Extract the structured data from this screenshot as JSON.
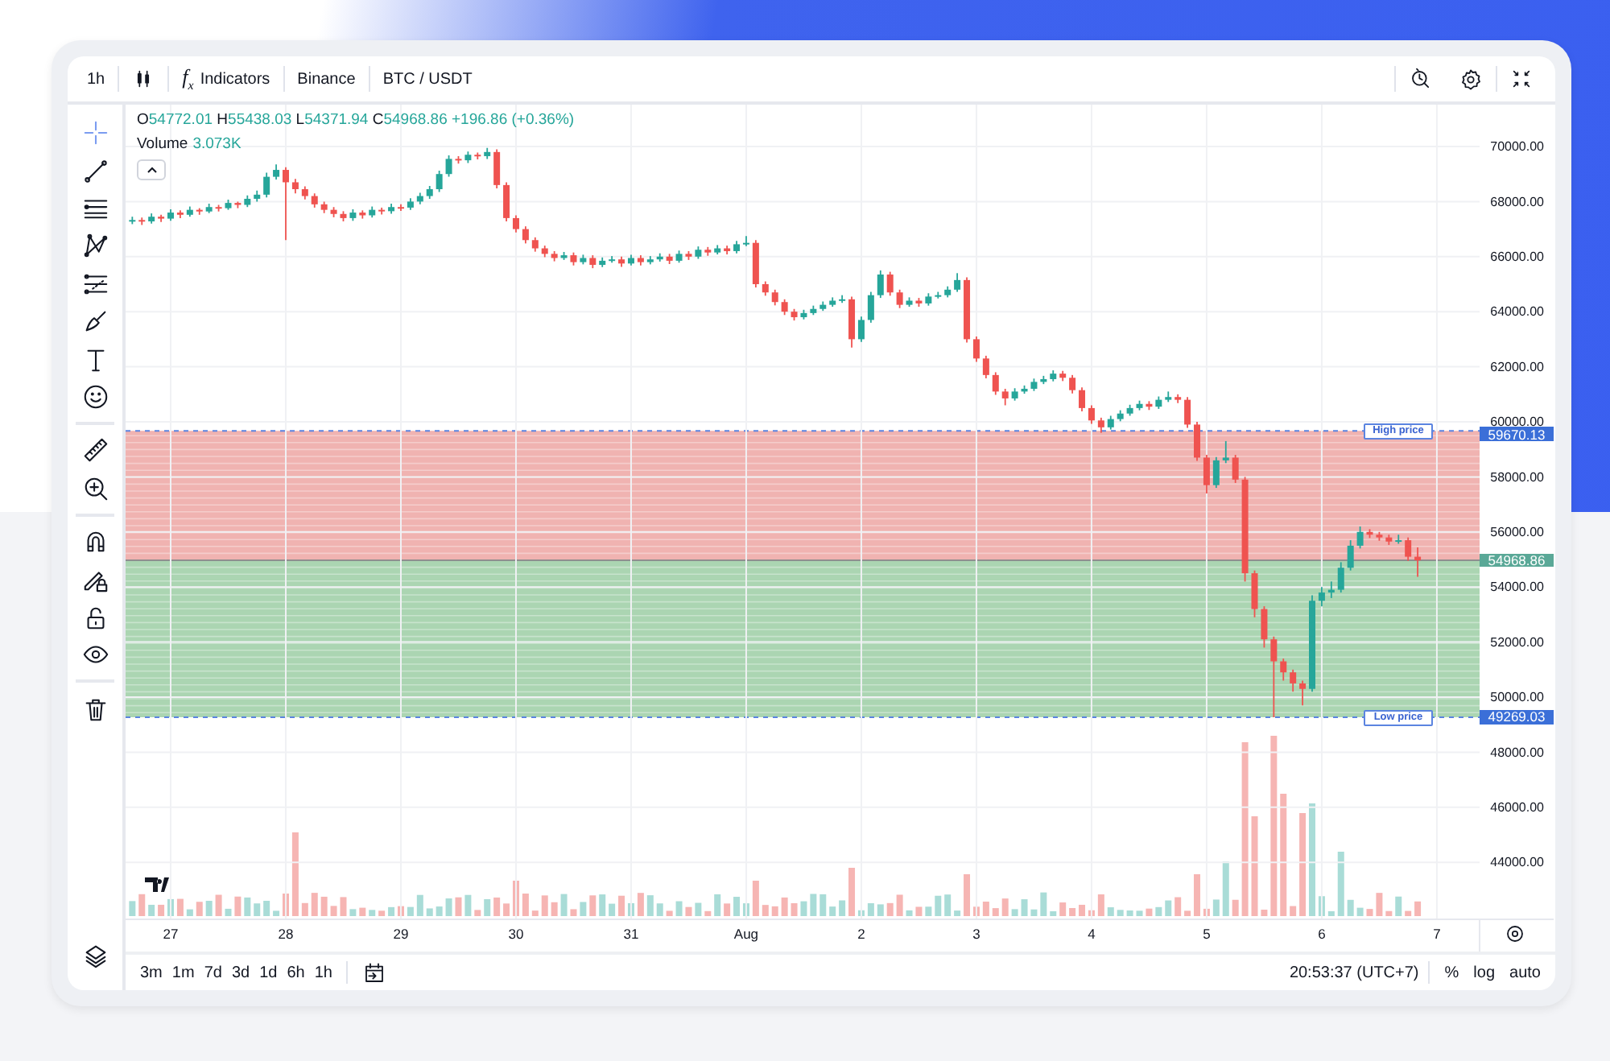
{
  "toolbar": {
    "interval": "1h",
    "indicators_symbol": "f$_{x}$",
    "indicators_label": "Indicators",
    "exchange": "Binance",
    "symbol": "BTC / USDT"
  },
  "legend": {
    "open_label": "O",
    "open": "54772.01",
    "high_label": "H",
    "high": "55438.03",
    "low_label": "L",
    "low": "54371.94",
    "close_label": "C",
    "close": "54968.86",
    "change": "+196.86 (+0.36%)",
    "volume_label": "Volume",
    "volume": "3.073K"
  },
  "chart_data": {
    "type": "candlestick",
    "categories": [
      null,
      null,
      null,
      null,
      "27",
      null,
      null,
      null,
      null,
      null,
      null,
      null,
      null,
      null,
      null,
      null,
      "28",
      null,
      null,
      null,
      null,
      null,
      null,
      null,
      null,
      null,
      null,
      null,
      "29",
      null,
      null,
      null,
      null,
      null,
      null,
      null,
      null,
      null,
      null,
      null,
      "30",
      null,
      null,
      null,
      null,
      null,
      null,
      null,
      null,
      null,
      null,
      null,
      "31",
      null,
      null,
      null,
      null,
      null,
      null,
      null,
      null,
      null,
      null,
      null,
      "Aug",
      null,
      null,
      null,
      null,
      null,
      null,
      null,
      null,
      null,
      null,
      null,
      "2",
      null,
      null,
      null,
      null,
      null,
      null,
      null,
      null,
      null,
      null,
      null,
      "3",
      null,
      null,
      null,
      null,
      null,
      null,
      null,
      null,
      null,
      null,
      null,
      "4",
      null,
      null,
      null,
      null,
      null,
      null,
      null,
      null,
      null,
      null,
      null,
      "5",
      null,
      null,
      null,
      null,
      null,
      null,
      null,
      null,
      null,
      null,
      null,
      "6",
      null,
      null,
      null,
      null,
      null,
      null,
      null,
      null,
      null,
      null,
      null,
      "7"
    ],
    "ohlc": [
      [
        67300,
        67450,
        67180,
        67330
      ],
      [
        67330,
        67420,
        67150,
        67280
      ],
      [
        67280,
        67570,
        67200,
        67450
      ],
      [
        67450,
        67520,
        67260,
        67380
      ],
      [
        67380,
        67720,
        67300,
        67600
      ],
      [
        67600,
        67680,
        67400,
        67520
      ],
      [
        67520,
        67820,
        67450,
        67700
      ],
      [
        67700,
        67760,
        67520,
        67640
      ],
      [
        67640,
        67920,
        67580,
        67800
      ],
      [
        67800,
        67880,
        67640,
        67760
      ],
      [
        67760,
        68070,
        67700,
        67950
      ],
      [
        67950,
        68000,
        67760,
        67880
      ],
      [
        67880,
        68220,
        67800,
        68100
      ],
      [
        68100,
        68400,
        68000,
        68250
      ],
      [
        68250,
        69050,
        68150,
        68900
      ],
      [
        68900,
        69350,
        68800,
        69150
      ],
      [
        69150,
        69250,
        66600,
        68700
      ],
      [
        68700,
        68820,
        68300,
        68450
      ],
      [
        68450,
        68550,
        68080,
        68200
      ],
      [
        68200,
        68300,
        67780,
        67900
      ],
      [
        67900,
        68000,
        67580,
        67700
      ],
      [
        67700,
        67800,
        67430,
        67550
      ],
      [
        67550,
        67650,
        67280,
        67400
      ],
      [
        67400,
        67720,
        67300,
        67600
      ],
      [
        67600,
        67680,
        67380,
        67500
      ],
      [
        67500,
        67820,
        67420,
        67700
      ],
      [
        67700,
        67780,
        67530,
        67650
      ],
      [
        67650,
        67920,
        67560,
        67800
      ],
      [
        67800,
        67900,
        67660,
        67780
      ],
      [
        67780,
        68120,
        67700,
        68000
      ],
      [
        68000,
        68320,
        67900,
        68200
      ],
      [
        68200,
        68570,
        68100,
        68450
      ],
      [
        68450,
        69120,
        68350,
        69000
      ],
      [
        69000,
        69680,
        68900,
        69550
      ],
      [
        69550,
        69650,
        69380,
        69500
      ],
      [
        69500,
        69820,
        69400,
        69700
      ],
      [
        69700,
        69780,
        69530,
        69650
      ],
      [
        69650,
        69950,
        69550,
        69800
      ],
      [
        69800,
        69900,
        68480,
        68600
      ],
      [
        68600,
        68700,
        67280,
        67400
      ],
      [
        67400,
        67500,
        66880,
        67000
      ],
      [
        67000,
        67100,
        66480,
        66600
      ],
      [
        66600,
        66700,
        66180,
        66300
      ],
      [
        66300,
        66400,
        65980,
        66100
      ],
      [
        66100,
        66200,
        65830,
        65950
      ],
      [
        65950,
        66170,
        65880,
        66050
      ],
      [
        66050,
        66150,
        65680,
        65800
      ],
      [
        65800,
        66070,
        65720,
        65950
      ],
      [
        65950,
        66050,
        65580,
        65700
      ],
      [
        65700,
        65970,
        65620,
        65850
      ],
      [
        65850,
        66020,
        65780,
        65900
      ],
      [
        65900,
        66000,
        65630,
        65750
      ],
      [
        65750,
        66070,
        65680,
        65950
      ],
      [
        65950,
        66050,
        65680,
        65800
      ],
      [
        65800,
        66020,
        65720,
        65900
      ],
      [
        65900,
        66120,
        65820,
        66000
      ],
      [
        66000,
        66100,
        65730,
        65850
      ],
      [
        65850,
        66220,
        65780,
        66100
      ],
      [
        66100,
        66200,
        65880,
        66000
      ],
      [
        66000,
        66370,
        65920,
        66250
      ],
      [
        66250,
        66350,
        66030,
        66150
      ],
      [
        66150,
        66420,
        66080,
        66300
      ],
      [
        66300,
        66400,
        66080,
        66200
      ],
      [
        66200,
        66570,
        66120,
        66450
      ],
      [
        66450,
        66750,
        66380,
        66500
      ],
      [
        66500,
        66600,
        64880,
        65000
      ],
      [
        65000,
        65100,
        64580,
        64700
      ],
      [
        64700,
        64800,
        64230,
        64350
      ],
      [
        64350,
        64450,
        63880,
        64000
      ],
      [
        64000,
        64100,
        63680,
        63800
      ],
      [
        63800,
        64070,
        63720,
        63950
      ],
      [
        63950,
        64220,
        63880,
        64100
      ],
      [
        64100,
        64370,
        64030,
        64250
      ],
      [
        64250,
        64520,
        64180,
        64400
      ],
      [
        64400,
        64600,
        64320,
        64450
      ],
      [
        64450,
        64550,
        62700,
        63000
      ],
      [
        63000,
        63820,
        62900,
        63700
      ],
      [
        63700,
        64720,
        63600,
        64600
      ],
      [
        64600,
        65500,
        64500,
        65350
      ],
      [
        65350,
        65450,
        64580,
        64700
      ],
      [
        64700,
        64800,
        64130,
        64250
      ],
      [
        64250,
        64520,
        64180,
        64400
      ],
      [
        64400,
        64500,
        64180,
        64300
      ],
      [
        64300,
        64670,
        64220,
        64550
      ],
      [
        64550,
        64720,
        64480,
        64600
      ],
      [
        64600,
        64920,
        64520,
        64800
      ],
      [
        64800,
        65400,
        64720,
        65150
      ],
      [
        65150,
        65250,
        62880,
        63000
      ],
      [
        63000,
        63100,
        62180,
        62300
      ],
      [
        62300,
        62400,
        61580,
        61700
      ],
      [
        61700,
        61800,
        60980,
        61100
      ],
      [
        61100,
        61200,
        60600,
        60850
      ],
      [
        60850,
        61220,
        60770,
        61100
      ],
      [
        61100,
        61320,
        61020,
        61200
      ],
      [
        61200,
        61570,
        61120,
        61450
      ],
      [
        61450,
        61670,
        61370,
        61550
      ],
      [
        61550,
        61870,
        61470,
        61750
      ],
      [
        61750,
        61850,
        61480,
        61600
      ],
      [
        61600,
        61700,
        61030,
        61150
      ],
      [
        61150,
        61250,
        60380,
        60500
      ],
      [
        60500,
        60600,
        59930,
        60050
      ],
      [
        60050,
        60150,
        59600,
        59800
      ],
      [
        59800,
        60220,
        59720,
        60100
      ],
      [
        60100,
        60420,
        60020,
        60300
      ],
      [
        60300,
        60620,
        60220,
        60500
      ],
      [
        60500,
        60770,
        60420,
        60650
      ],
      [
        60650,
        60750,
        60430,
        60550
      ],
      [
        60550,
        60920,
        60470,
        60800
      ],
      [
        60800,
        61100,
        60720,
        60900
      ],
      [
        60900,
        61000,
        60680,
        60800
      ],
      [
        60800,
        60900,
        59780,
        59900
      ],
      [
        59900,
        60000,
        58580,
        58700
      ],
      [
        58700,
        58800,
        57400,
        57700
      ],
      [
        57700,
        58720,
        57600,
        58600
      ],
      [
        58600,
        59300,
        58500,
        58700
      ],
      [
        58700,
        58800,
        57780,
        57900
      ],
      [
        57900,
        58000,
        54200,
        54500
      ],
      [
        54500,
        54600,
        52900,
        53200
      ],
      [
        53200,
        53300,
        51800,
        52100
      ],
      [
        52100,
        52200,
        49269,
        51300
      ],
      [
        51300,
        51400,
        50600,
        50900
      ],
      [
        50900,
        51000,
        50200,
        50500
      ],
      [
        50500,
        50600,
        49700,
        50300
      ],
      [
        50300,
        53700,
        50200,
        53500
      ],
      [
        53500,
        54000,
        53300,
        53800
      ],
      [
        53800,
        54200,
        53600,
        53900
      ],
      [
        53900,
        54900,
        53800,
        54700
      ],
      [
        54700,
        55700,
        54600,
        55500
      ],
      [
        55500,
        56200,
        55400,
        56000
      ],
      [
        56000,
        56100,
        55780,
        55900
      ],
      [
        55900,
        56000,
        55680,
        55800
      ],
      [
        55800,
        55900,
        55530,
        55650
      ],
      [
        55650,
        55900,
        55570,
        55700
      ],
      [
        55700,
        55800,
        54950,
        55100
      ],
      [
        55100,
        55438,
        54371,
        54969
      ],
      null,
      null
    ],
    "ylim": [
      41930,
      71520
    ],
    "grid": true,
    "yticks": [
      {
        "value": 70000,
        "label": "70000.00"
      },
      {
        "value": 68000,
        "label": "68000.00"
      },
      {
        "value": 66000,
        "label": "66000.00"
      },
      {
        "value": 64000,
        "label": "64000.00"
      },
      {
        "value": 62000,
        "label": "62000.00"
      },
      {
        "value": 60000,
        "label": "60000.00"
      },
      {
        "value": 58000,
        "label": "58000.00"
      },
      {
        "value": 56000,
        "label": "56000.00"
      },
      {
        "value": 54000,
        "label": "54000.00"
      },
      {
        "value": 52000,
        "label": "52000.00"
      },
      {
        "value": 50000,
        "label": "50000.00"
      },
      {
        "value": 48000,
        "label": "48000.00"
      },
      {
        "value": 46000,
        "label": "46000.00"
      },
      {
        "value": 44000,
        "label": "44000.00"
      }
    ]
  },
  "price_range": {
    "high_label": "High price",
    "high_value": "59670.13",
    "current_value": "54968.86",
    "low_label": "Low price",
    "low_value": "49269.03"
  },
  "bottom_bar": {
    "ranges": [
      "3m",
      "1m",
      "7d",
      "3d",
      "1d",
      "6h",
      "1h"
    ],
    "time": "20:53:37 (UTC+7)",
    "options": [
      "%",
      "log",
      "auto"
    ]
  }
}
